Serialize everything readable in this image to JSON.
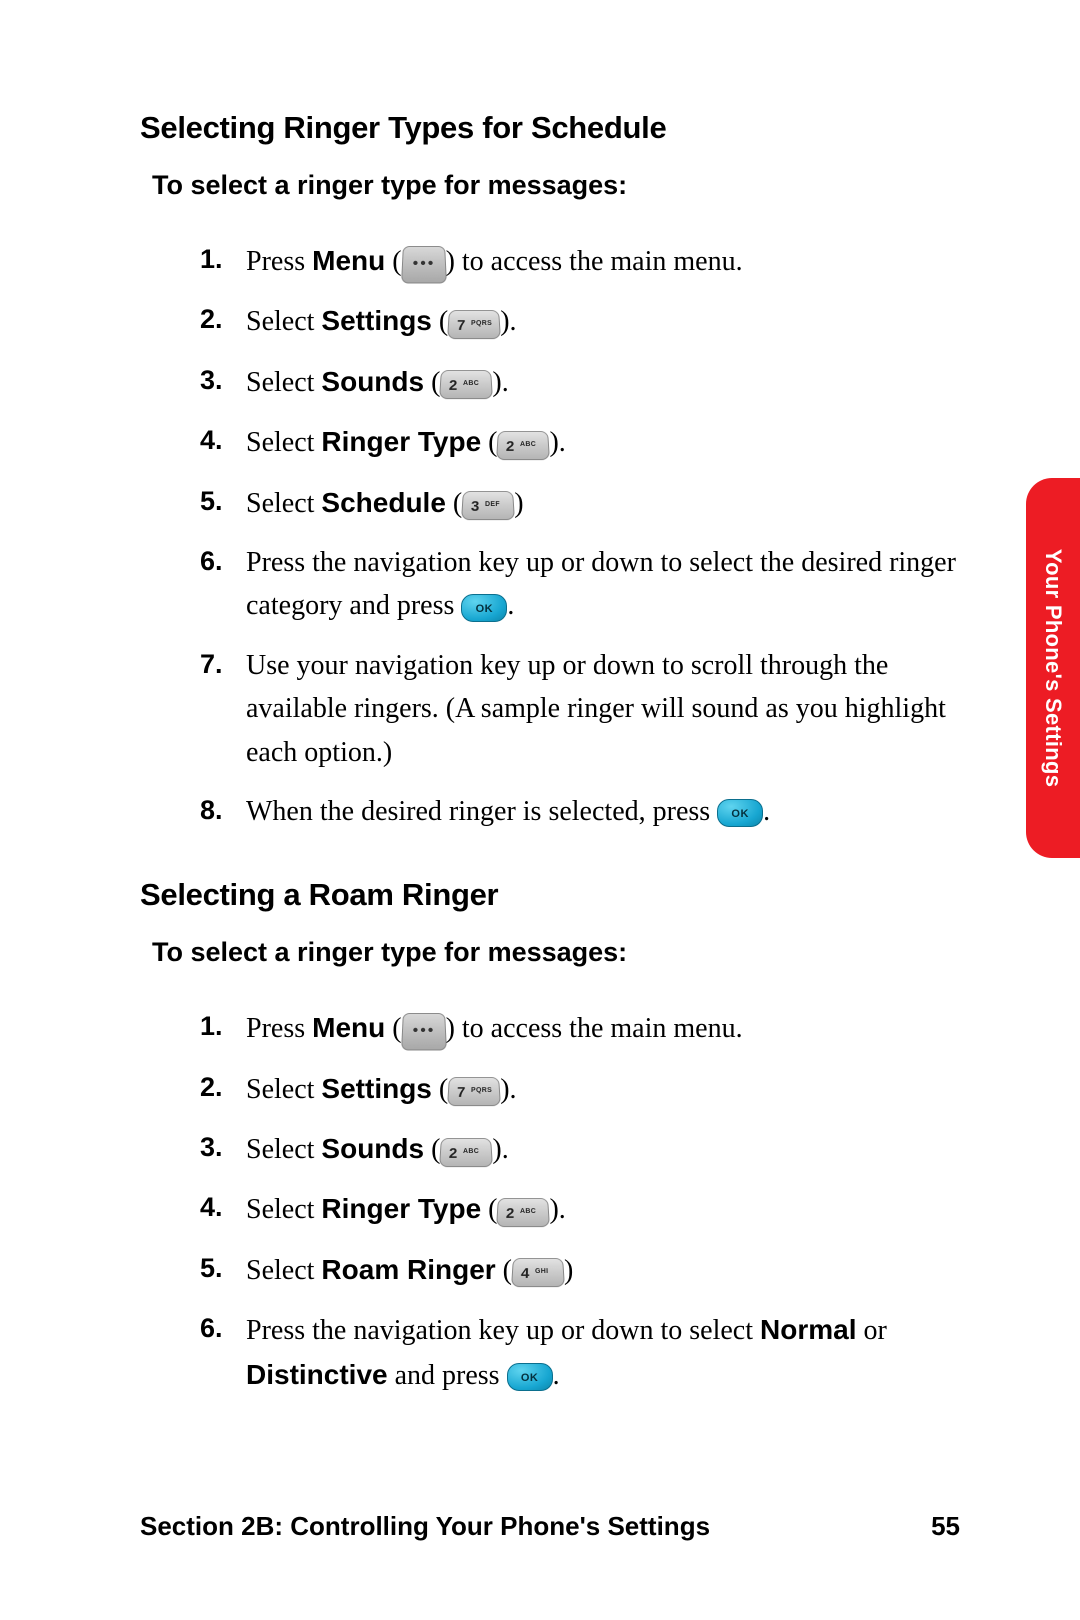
{
  "sideTab": "Your Phone's Settings",
  "footer": {
    "section": "Section 2B: Controlling Your Phone's Settings",
    "page": "55"
  },
  "sec1": {
    "heading": "Selecting Ringer Types for Schedule",
    "sub": "To select a ringer type for messages:",
    "s1a": "Press ",
    "s1b": "Menu",
    "s1c": " (",
    "s1d": ") to access the main menu.",
    "s2a": "Select ",
    "s2b": "Settings",
    "s2c": " (",
    "s2d": ").",
    "s3a": "Select ",
    "s3b": "Sounds",
    "s3c": " (",
    "s3d": ").",
    "s4a": "Select ",
    "s4b": "Ringer Type",
    "s4c": " (",
    "s4d": ").",
    "s5a": "Select ",
    "s5b": "Schedule",
    "s5c": " (",
    "s5d": ")",
    "s6a": "Press the navigation key up or down to select the desired ringer category and press ",
    "s6b": ".",
    "s7": "Use your navigation key up or down to scroll through the available ringers. (A sample ringer will sound as you highlight each option.)",
    "s8a": "When the desired ringer is selected, press ",
    "s8b": "."
  },
  "sec2": {
    "heading": "Selecting a Roam Ringer",
    "sub": "To select a ringer type for messages:",
    "s1a": "Press ",
    "s1b": "Menu",
    "s1c": " (",
    "s1d": ") to access the main menu.",
    "s2a": "Select ",
    "s2b": "Settings",
    "s2c": " (",
    "s2d": ").",
    "s3a": "Select ",
    "s3b": "Sounds",
    "s3c": " (",
    "s3d": ").",
    "s4a": "Select ",
    "s4b": "Ringer Type",
    "s4c": " (",
    "s4d": ").",
    "s5a": "Select ",
    "s5b": "Roam Ringer",
    "s5c": " (",
    "s5d": ")",
    "s6a": "Press the navigation key up or down to select ",
    "s6b": "Normal",
    "s6c": " or ",
    "s6d": "Distinctive",
    "s6e": " and press ",
    "s6f": "."
  },
  "keys": {
    "k7n": "7",
    "k7l": "PQRS",
    "k2n": "2",
    "k2l": "ABC",
    "k3n": "3",
    "k3l": "DEF",
    "k4n": "4",
    "k4l": "GHI"
  }
}
